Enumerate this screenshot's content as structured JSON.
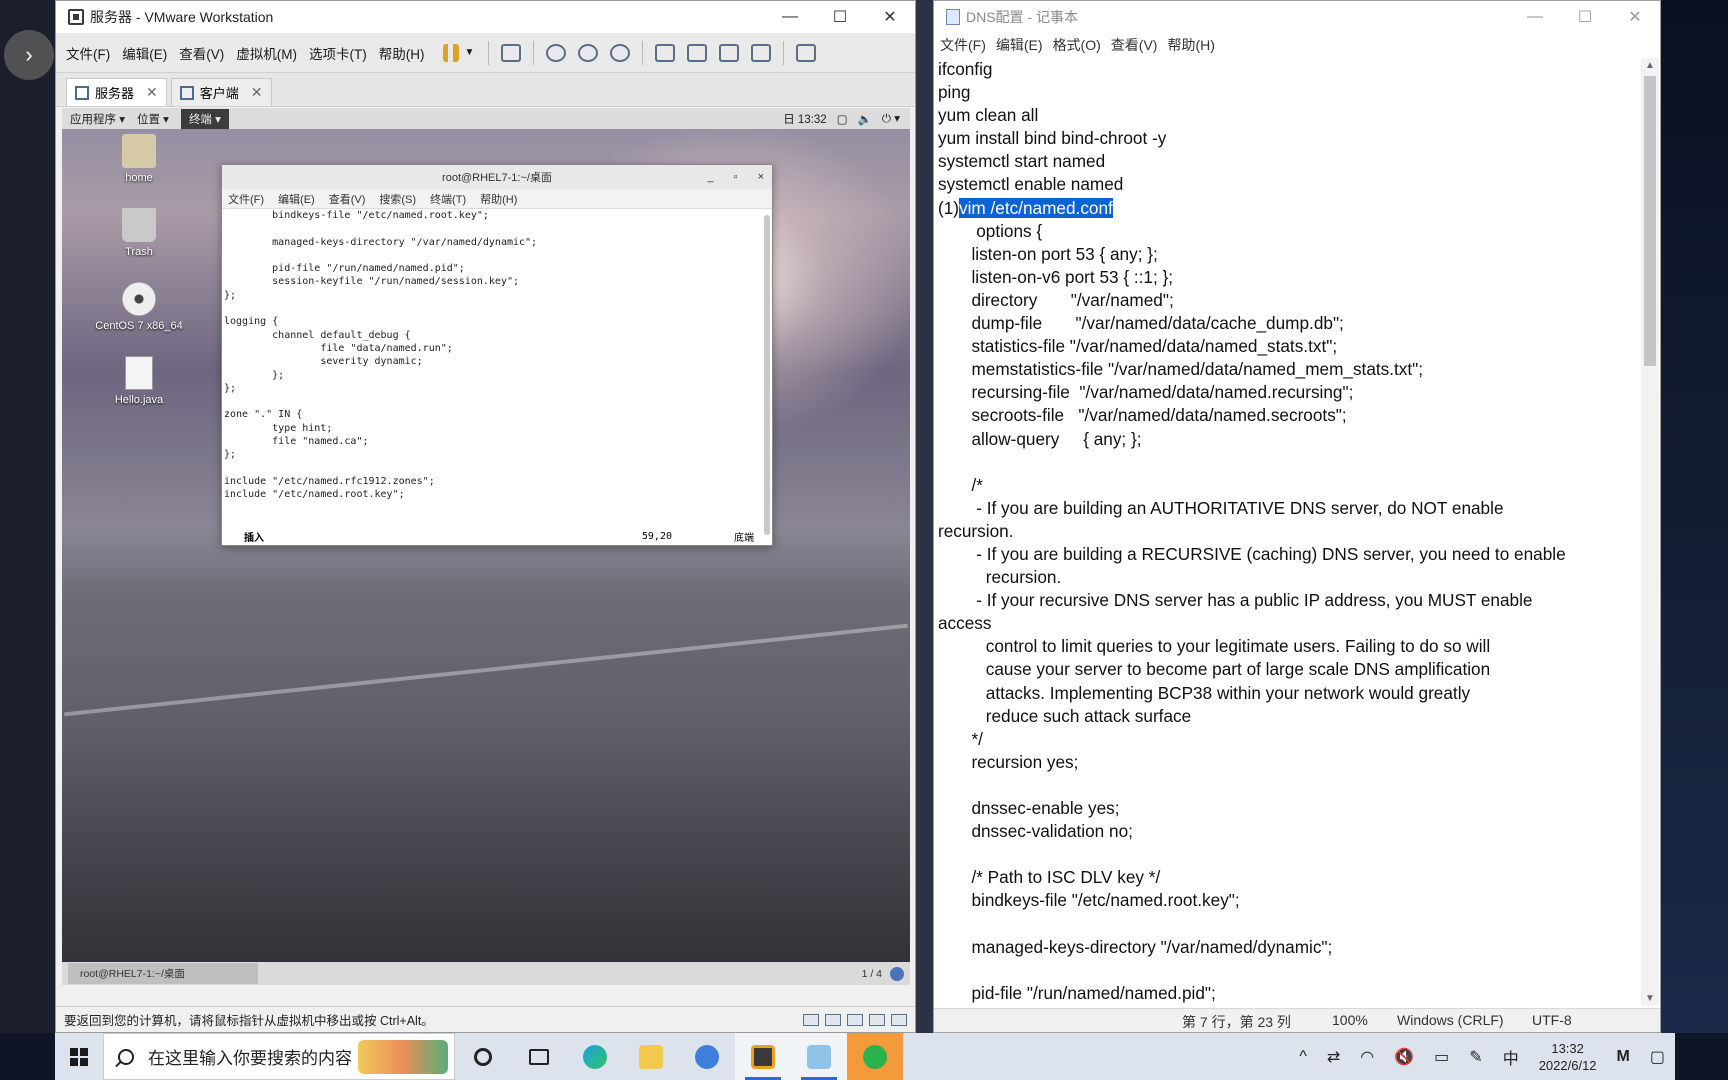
{
  "vmware": {
    "title": "服务器 - VMware Workstation",
    "menu": [
      "文件(F)",
      "编辑(E)",
      "查看(V)",
      "虚拟机(M)",
      "选项卡(T)",
      "帮助(H)"
    ],
    "tabs": [
      {
        "label": "服务器",
        "active": true
      },
      {
        "label": "客户端",
        "active": false
      }
    ],
    "status_hint": "要返回到您的计算机，请将鼠标指针从虚拟机中移出或按 Ctrl+Alt。"
  },
  "guest": {
    "panel": {
      "apps": "应用程序",
      "places": "位置",
      "terminal": "终端",
      "clock": "日 13:32"
    },
    "desktop_icons": [
      {
        "label": "home",
        "icon": "home-folder-icon"
      },
      {
        "label": "Trash",
        "icon": "trash-icon"
      },
      {
        "label": "CentOS 7 x86_64",
        "icon": "disc-icon"
      },
      {
        "label": "Hello.java",
        "icon": "file-icon"
      }
    ],
    "bottom": {
      "task": "root@RHEL7-1:~/桌面",
      "workspace": "1 / 4"
    },
    "terminal": {
      "title": "root@RHEL7-1:~/桌面",
      "menu": [
        "文件(F)",
        "编辑(E)",
        "查看(V)",
        "搜索(S)",
        "终端(T)",
        "帮助(H)"
      ],
      "lines": [
        "        bindkeys-file \"/etc/named.root.key\";",
        "",
        "        managed-keys-directory \"/var/named/dynamic\";",
        "",
        "        pid-file \"/run/named/named.pid\";",
        "        session-keyfile \"/run/named/session.key\";",
        "};",
        "",
        "logging {",
        "        channel default_debug {",
        "                file \"data/named.run\";",
        "                severity dynamic;",
        "        };",
        "};",
        "",
        "zone \".\" IN {",
        "        type hint;",
        "        file \"named.ca\";",
        "};",
        "",
        "include \"/etc/named.rfc1912.zones\";",
        "include \"/etc/named.root.key\";"
      ],
      "mode": "插入",
      "position": "59,20",
      "scroll": "底端"
    }
  },
  "notepad": {
    "title": "DNS配置 - 记事本",
    "menu": [
      "文件(F)",
      "编辑(E)",
      "格式(O)",
      "查看(V)",
      "帮助(H)"
    ],
    "highlight": "vim /etc/named.conf",
    "lines": [
      "ifconfig",
      "ping",
      "yum clean all",
      "yum install bind bind-chroot -y",
      "systemctl start named",
      "systemctl enable named",
      "(1)vim /etc/named.conf",
      "        options {",
      "       listen-on port 53 { any; };",
      "       listen-on-v6 port 53 { ::1; };",
      "       directory       \"/var/named\";",
      "       dump-file       \"/var/named/data/cache_dump.db\";",
      "       statistics-file \"/var/named/data/named_stats.txt\";",
      "       memstatistics-file \"/var/named/data/named_mem_stats.txt\";",
      "       recursing-file  \"/var/named/data/named.recursing\";",
      "       secroots-file   \"/var/named/data/named.secroots\";",
      "       allow-query     { any; };",
      "",
      "       /*",
      "        - If you are building an AUTHORITATIVE DNS server, do NOT enable",
      "recursion.",
      "        - If you are building a RECURSIVE (caching) DNS server, you need to enable",
      "          recursion.",
      "        - If your recursive DNS server has a public IP address, you MUST enable",
      "access",
      "          control to limit queries to your legitimate users. Failing to do so will",
      "          cause your server to become part of large scale DNS amplification",
      "          attacks. Implementing BCP38 within your network would greatly",
      "          reduce such attack surface",
      "       */",
      "       recursion yes;",
      "",
      "       dnssec-enable yes;",
      "       dnssec-validation no;",
      "",
      "       /* Path to ISC DLV key */",
      "       bindkeys-file \"/etc/named.root.key\";",
      "",
      "       managed-keys-directory \"/var/named/dynamic\";",
      "",
      "       pid-file \"/run/named/named.pid\";"
    ],
    "status": {
      "cursor": "第 7 行，第 23 列",
      "zoom": "100%",
      "eol": "Windows (CRLF)",
      "encoding": "UTF-8"
    }
  },
  "taskbar": {
    "search_placeholder": "在这里输入你要搜索的内容",
    "ime": "中",
    "time": "13:32",
    "date": "2022/6/12"
  }
}
